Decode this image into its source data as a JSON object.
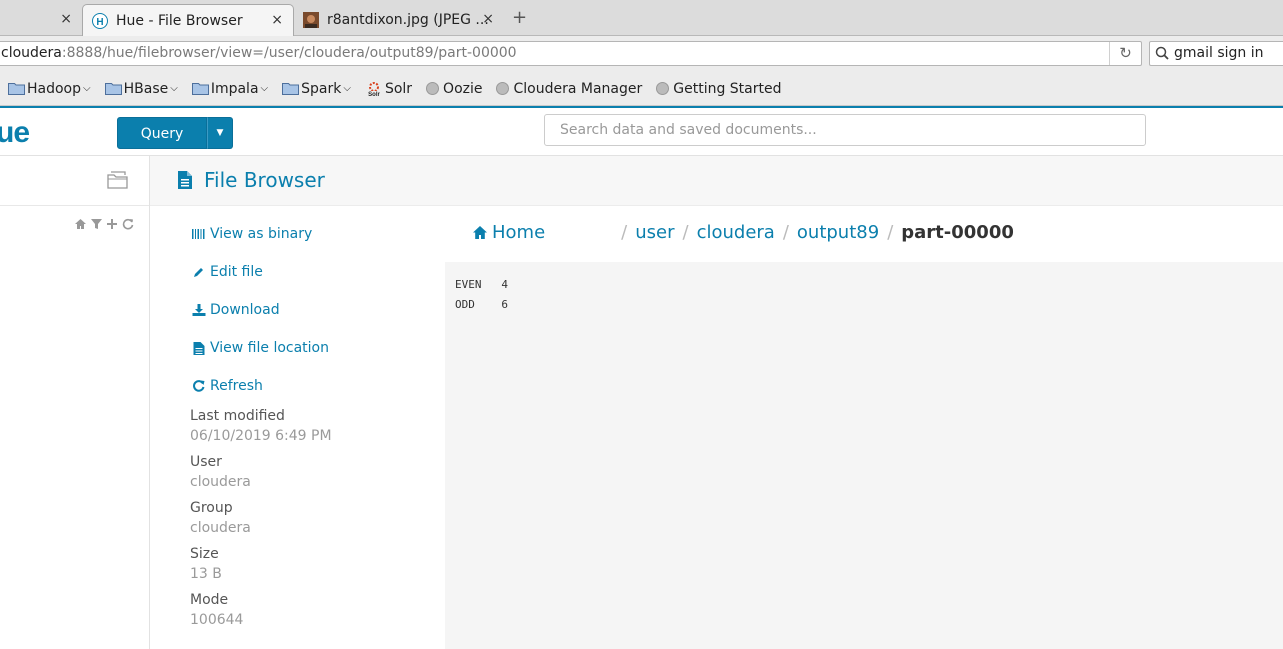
{
  "browser": {
    "tabs": [
      {
        "label": "",
        "close": "×"
      },
      {
        "label": "Hue - File Browser",
        "close": "×"
      },
      {
        "label": "r8antdixon.jpg (JPEG ...",
        "close": "×"
      }
    ],
    "new_tab": "+",
    "url_host": "cloudera",
    "url_rest": ":8888/hue/filebrowser/view=/user/cloudera/output89/part-00000",
    "reload_icon": "↻",
    "search_value": "gmail sign in",
    "bookmarks": [
      {
        "label": "Hadoop",
        "icon": "folder-icon",
        "dropdown": true
      },
      {
        "label": "HBase",
        "icon": "folder-icon",
        "dropdown": true
      },
      {
        "label": "Impala",
        "icon": "folder-icon",
        "dropdown": true
      },
      {
        "label": "Spark",
        "icon": "folder-icon",
        "dropdown": true
      },
      {
        "label": "Solr",
        "icon": "solr-icon",
        "dropdown": false
      },
      {
        "label": "Oozie",
        "icon": "globe-icon",
        "dropdown": false
      },
      {
        "label": "Cloudera Manager",
        "icon": "globe-icon",
        "dropdown": false
      },
      {
        "label": "Getting Started",
        "icon": "globe-icon",
        "dropdown": false
      }
    ]
  },
  "hue": {
    "logo": "ue",
    "query_button": "Query",
    "search_placeholder": "Search data and saved documents...",
    "page_title": "File Browser",
    "actions": [
      {
        "label": "View as binary",
        "icon": "binary-icon"
      },
      {
        "label": "Edit file",
        "icon": "pencil-icon"
      },
      {
        "label": "Download",
        "icon": "download-icon"
      },
      {
        "label": "View file location",
        "icon": "file-icon"
      },
      {
        "label": "Refresh",
        "icon": "refresh-icon"
      }
    ],
    "meta": [
      {
        "label": "Last modified",
        "value": "06/10/2019 6:49 PM"
      },
      {
        "label": "User",
        "value": "cloudera"
      },
      {
        "label": "Group",
        "value": "cloudera"
      },
      {
        "label": "Size",
        "value": "13 B"
      },
      {
        "label": "Mode",
        "value": "100644"
      }
    ],
    "breadcrumb": {
      "home": "Home",
      "parts": [
        "user",
        "cloudera",
        "output89"
      ],
      "current": "part-00000",
      "separator": "/"
    },
    "file_content": "EVEN\t4\nODD\t6"
  },
  "colors": {
    "accent": "#0b7fad",
    "muted": "#9a9a9a"
  }
}
